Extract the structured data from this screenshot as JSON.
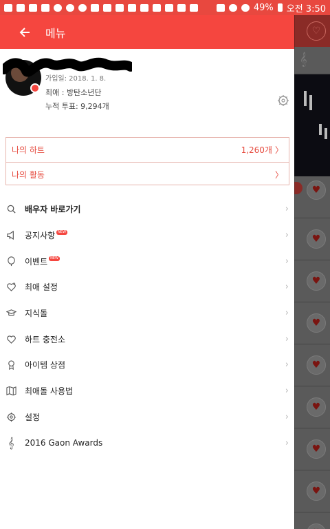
{
  "statusbar": {
    "battery": "49%",
    "time": "오전 3:50"
  },
  "drawer": {
    "title": "메뉴",
    "profile": {
      "join_label": "가입일: 2018. 1. 8.",
      "favorite": "최애 : 방탄소년단",
      "votes": "누적 투표: 9,294개"
    },
    "boxes": {
      "hearts_label": "나의 하트",
      "hearts_value": "1,260개",
      "activity_label": "나의 활동"
    },
    "menu": [
      {
        "label": "배우자 바로가기",
        "icon": "person-search-icon",
        "bold": true,
        "new": false
      },
      {
        "label": "공지사항",
        "icon": "megaphone-icon",
        "bold": false,
        "new": true
      },
      {
        "label": "이벤트",
        "icon": "balloon-icon",
        "bold": false,
        "new": true
      },
      {
        "label": "최애 설정",
        "icon": "heart-plus-icon",
        "bold": false,
        "new": false
      },
      {
        "label": "지식돌",
        "icon": "graduation-cap-icon",
        "bold": false,
        "new": false
      },
      {
        "label": "하트 충전소",
        "icon": "heart-charge-icon",
        "bold": false,
        "new": false
      },
      {
        "label": "아이템 상점",
        "icon": "badge-icon",
        "bold": false,
        "new": false
      },
      {
        "label": "최애돌 사용법",
        "icon": "map-icon",
        "bold": false,
        "new": false
      },
      {
        "label": "설정",
        "icon": "gear-icon",
        "bold": false,
        "new": false
      },
      {
        "label": "2016 Gaon Awards",
        "icon": "clef-icon",
        "bold": false,
        "new": false
      }
    ],
    "new_badge": "NEW"
  },
  "colors": {
    "accent": "#f5463f",
    "accent_text": "#e64b3f"
  }
}
